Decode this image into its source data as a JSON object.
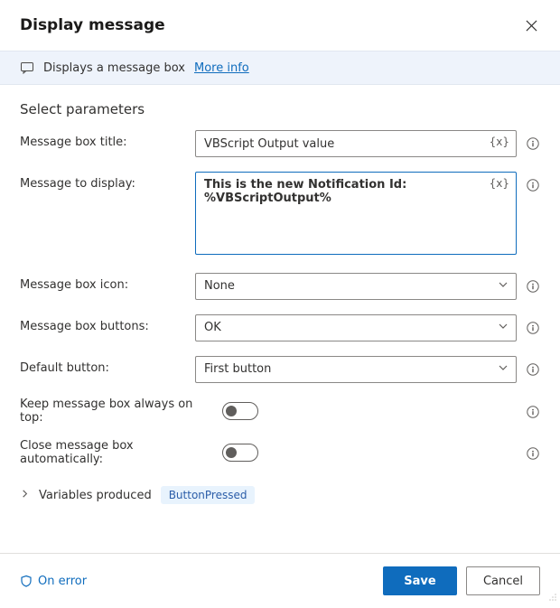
{
  "header": {
    "title": "Display message"
  },
  "banner": {
    "text": "Displays a message box",
    "link": "More info"
  },
  "params": {
    "heading": "Select parameters",
    "fields": {
      "titleLabel": "Message box title:",
      "titleValue": "VBScript Output value",
      "messageLabel": "Message to display:",
      "messageValue": "This is the new Notification Id: %VBScriptOutput%",
      "iconLabel": "Message box icon:",
      "iconValue": "None",
      "buttonsLabel": "Message box buttons:",
      "buttonsValue": "OK",
      "defaultLabel": "Default button:",
      "defaultValue": "First button",
      "alwaysTopLabel": "Keep message box always on top:",
      "autoCloseLabel": "Close message box automatically:"
    },
    "variablesProduced": {
      "label": "Variables produced",
      "name": "ButtonPressed"
    },
    "varTokenGlyph": "{x}"
  },
  "footer": {
    "onError": "On error",
    "save": "Save",
    "cancel": "Cancel"
  },
  "toggles": {
    "alwaysTop": false,
    "autoClose": false
  }
}
